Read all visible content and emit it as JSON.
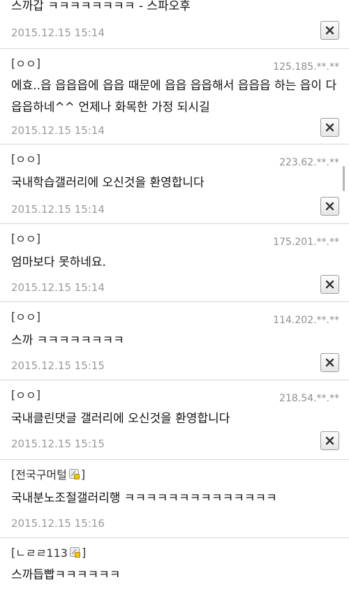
{
  "comments": [
    {
      "author": "",
      "ip": "",
      "content": [
        "스까갑 ㅋㅋㅋㅋㅋㅋㅋㅋ - 스파오후"
      ],
      "date": "2015.12.15 15:14",
      "close_label": "×"
    },
    {
      "author": "ㅇㅇ",
      "ip": "125.185.**.**",
      "content": [
        "에효..읍 읍읍읍에 읍읍 때문에 읍읍 읍읍해서 읍읍읍 하는 읍이 다",
        "읍읍하네^^ 언제나 화목한 가정 되시길"
      ],
      "date": "2015.12.15 15:14",
      "close_label": "×"
    },
    {
      "author": "ㅇㅇ",
      "ip": "223.62.**.**",
      "content": [
        "국내학습갤러리에 오신것을 환영합니다"
      ],
      "date": "2015.12.15 15:14",
      "close_label": "×"
    },
    {
      "author": "ㅇㅇ",
      "ip": "175.201.**.**",
      "content": [
        "엄마보다 못하네요."
      ],
      "date": "2015.12.15 15:14",
      "close_label": "×"
    },
    {
      "author": "ㅇㅇ",
      "ip": "114.202.**.**",
      "content": [
        "스까 ㅋㅋㅋㅋㅋㅋㅋㅋ"
      ],
      "date": "2015.12.15 15:15",
      "close_label": "×"
    },
    {
      "author": "ㅇㅇ",
      "ip": "218.54.**.**",
      "content": [
        "국내클린댓글 갤러리에 오신것을 환영합니다"
      ],
      "date": "2015.12.15 15:15",
      "close_label": "×"
    },
    {
      "author": "전국구머털",
      "ip": "",
      "content": [
        "국내분노조절갤러리행 ㅋㅋㅋㅋㅋㅋㅋㅋㅋㅋㅋㅋㅋㅋ"
      ],
      "date": "2015.12.15 15:16",
      "close_label": ""
    },
    {
      "author": "ㄴㄹㄹ113",
      "ip": "",
      "content": [
        "스까듭빱ㅋㅋㅋㅋㅋㅋ"
      ],
      "date": "",
      "close_label": ""
    }
  ],
  "brackets": {
    "open": "[",
    "close": "]"
  },
  "icons": {
    "close": "close-icon",
    "member": "member-badge-icon"
  },
  "colors": {
    "text": "#111111",
    "meta": "#9a9a9a",
    "divider": "#d8d8d8",
    "member_badge": "#f2c200"
  }
}
